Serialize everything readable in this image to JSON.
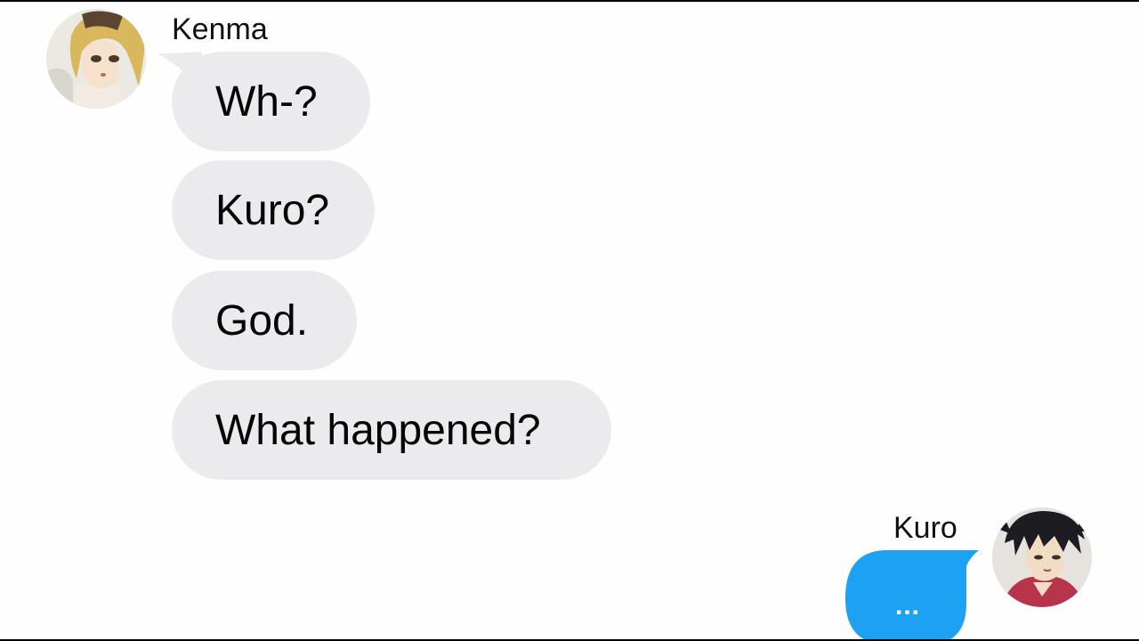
{
  "conversation": {
    "incoming": {
      "sender_name": "Kenma",
      "avatar_icon": "kenma-avatar",
      "messages": [
        "Wh-?",
        "Kuro?",
        "God.",
        "What happened?"
      ]
    },
    "outgoing": {
      "sender_name": "Kuro",
      "avatar_icon": "kuro-avatar",
      "typing_indicator": "..."
    }
  },
  "colors": {
    "incoming_bubble": "#ebebee",
    "outgoing_bubble": "#1da1f2",
    "background": "#fefefe"
  }
}
